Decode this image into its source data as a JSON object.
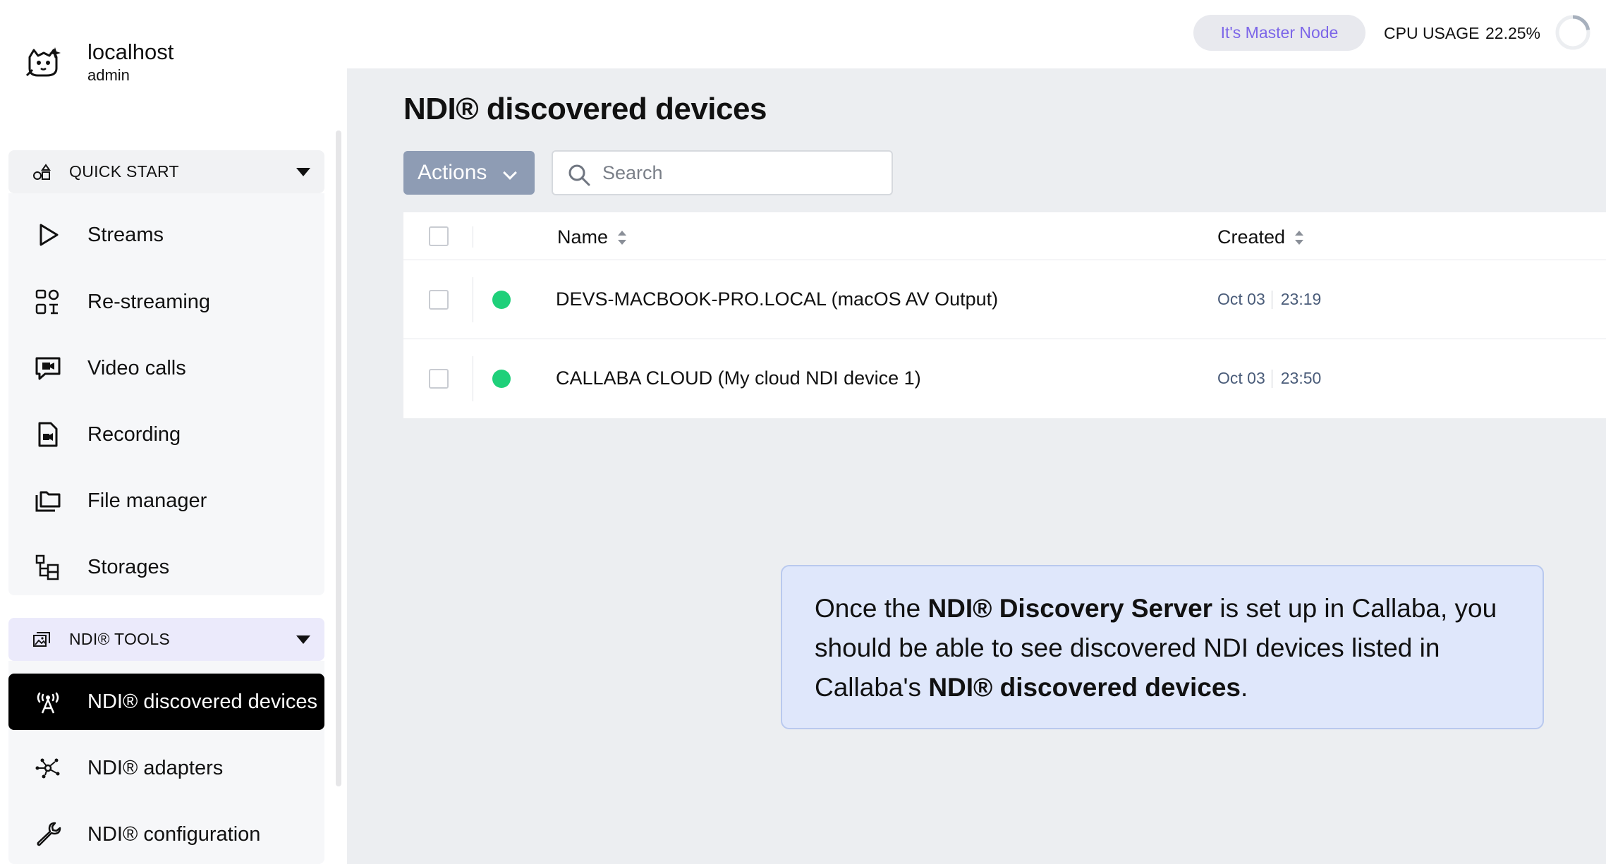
{
  "brand": {
    "host": "localhost",
    "user": "admin"
  },
  "topbar": {
    "master_badge": "It's Master Node",
    "cpu_label": "CPU USAGE",
    "cpu_value": "22.25%",
    "cpu_fraction": 0.2225
  },
  "sidebar": {
    "quick_start": {
      "label": "QUICK START",
      "items": [
        {
          "label": "Streams",
          "icon": "play-icon"
        },
        {
          "label": "Re-streaming",
          "icon": "restream-icon"
        },
        {
          "label": "Video calls",
          "icon": "video-call-icon"
        },
        {
          "label": "Recording",
          "icon": "recording-file-icon"
        },
        {
          "label": "File manager",
          "icon": "folders-icon"
        },
        {
          "label": "Storages",
          "icon": "storage-tree-icon"
        }
      ]
    },
    "ndi_tools": {
      "label": "NDI® TOOLS",
      "items": [
        {
          "label": "NDI® discovered devices",
          "icon": "antenna-icon",
          "active": true
        },
        {
          "label": "NDI® adapters",
          "icon": "network-nodes-icon"
        },
        {
          "label": "NDI® configuration",
          "icon": "wrench-icon"
        }
      ]
    }
  },
  "main": {
    "title": "NDI® discovered devices",
    "actions_label": "Actions",
    "search_placeholder": "Search",
    "columns": {
      "name": "Name",
      "created": "Created"
    },
    "rows": [
      {
        "name": "DEVS-MACBOOK-PRO.LOCAL (macOS AV Output)",
        "date": "Oct 03",
        "time": "23:19",
        "status": "online"
      },
      {
        "name": "CALLABA CLOUD (My cloud NDI device 1)",
        "date": "Oct 03",
        "time": "23:50",
        "status": "online"
      }
    ]
  },
  "callout": {
    "part1": "Once the ",
    "bold1": "NDI® Discovery Server",
    "part2": " is set up in Callaba, you should be able to see discovered NDI devices listed in Callaba's ",
    "bold2": "NDI® discovered devices",
    "part3": "."
  },
  "colors": {
    "accent": "#7c66e8",
    "status_online": "#1fd07a",
    "actions_button": "#8e9cb4",
    "callout_bg": "#dfe7fb",
    "active_nav": "#000000"
  }
}
